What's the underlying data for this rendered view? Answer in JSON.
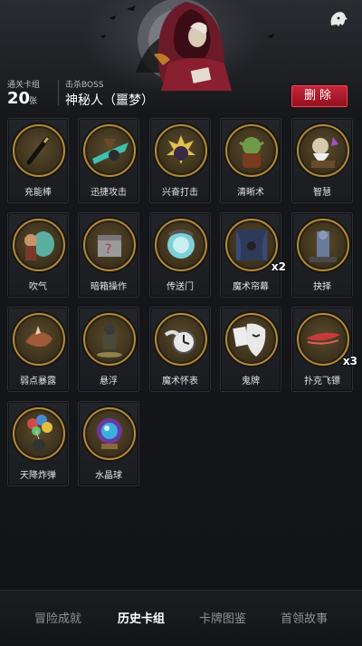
{
  "header": {
    "cards_label": "通关卡组",
    "cards_count": "20",
    "cards_unit": "张",
    "boss_label": "击杀BOSS",
    "boss_name": "神秘人（噩梦）",
    "delete_label": "删除"
  },
  "cards": [
    {
      "name": "充能棒",
      "icon": "wand-icon"
    },
    {
      "name": "迅捷攻击",
      "icon": "swift-attack-icon"
    },
    {
      "name": "兴奋打击",
      "icon": "excited-strike-icon"
    },
    {
      "name": "清晰术",
      "icon": "goblin-clarity-icon"
    },
    {
      "name": "智慧",
      "icon": "wise-man-icon"
    },
    {
      "name": "吹气",
      "icon": "balloon-blow-icon"
    },
    {
      "name": "暗箱操作",
      "icon": "mystery-box-icon"
    },
    {
      "name": "传送门",
      "icon": "portal-icon"
    },
    {
      "name": "魔术帘幕",
      "icon": "magic-curtain-icon",
      "count": "x2"
    },
    {
      "name": "抉择",
      "icon": "statue-choice-icon"
    },
    {
      "name": "弱点暴露",
      "icon": "weakness-icon"
    },
    {
      "name": "悬浮",
      "icon": "levitation-icon"
    },
    {
      "name": "魔术怀表",
      "icon": "pocket-watch-icon"
    },
    {
      "name": "鬼牌",
      "icon": "joker-mask-icon"
    },
    {
      "name": "扑克飞镖",
      "icon": "poker-dart-icon",
      "count": "x3"
    },
    {
      "name": "天降炸弹",
      "icon": "balloon-bomb-icon"
    },
    {
      "name": "水晶球",
      "icon": "crystal-ball-icon"
    }
  ],
  "tabs": [
    {
      "label": "冒险成就",
      "active": false
    },
    {
      "label": "历史卡组",
      "active": true
    },
    {
      "label": "卡牌图鉴",
      "active": false
    },
    {
      "label": "首领故事",
      "active": false
    }
  ],
  "colors": {
    "delete_red": "#c8263a",
    "card_rim": "#b08a3e",
    "background": "#121417"
  }
}
